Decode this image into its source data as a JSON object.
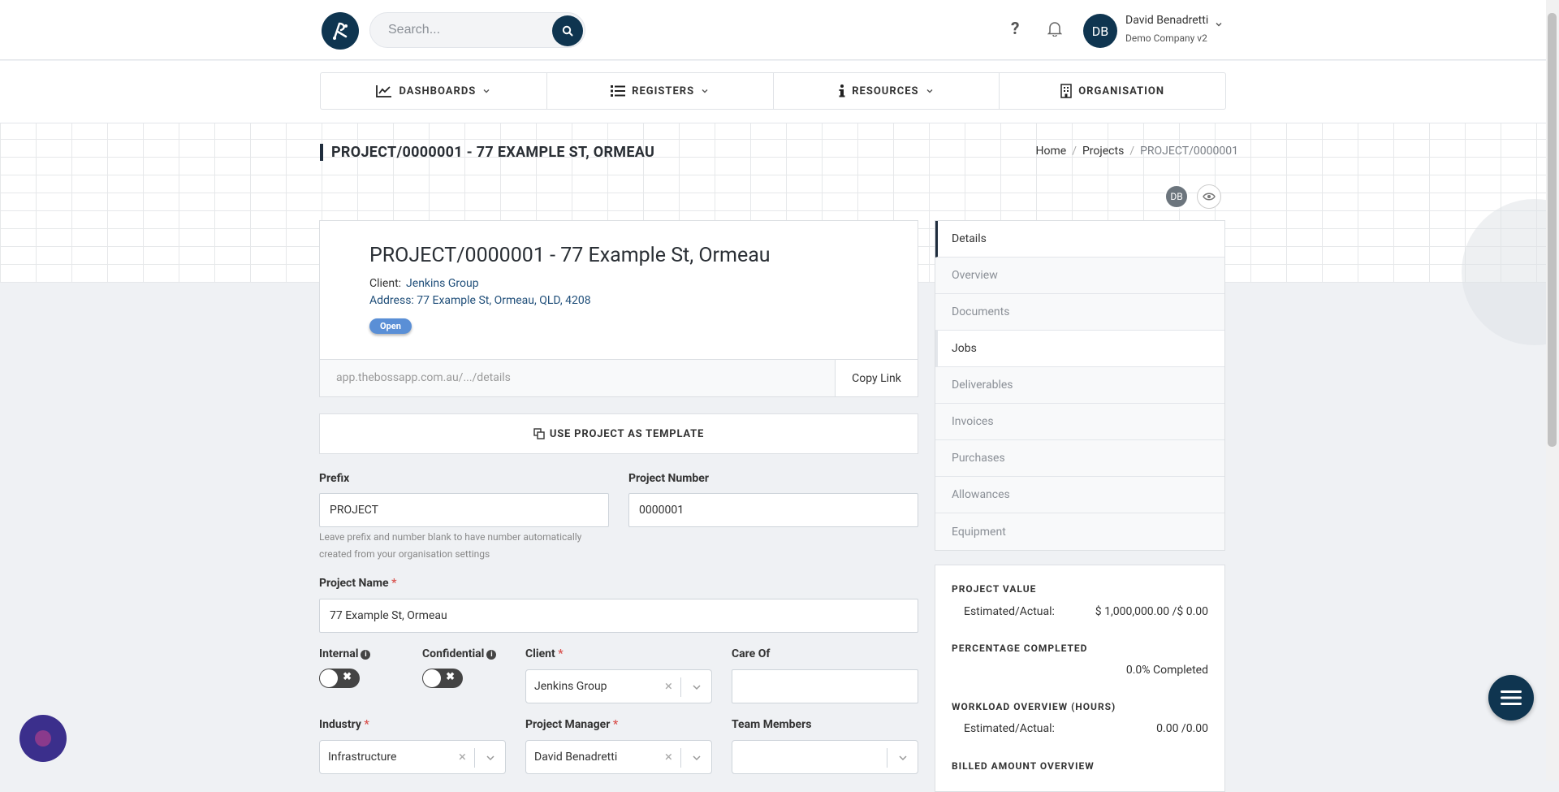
{
  "search": {
    "placeholder": "Search..."
  },
  "user": {
    "initials": "DB",
    "name": "David Benadretti",
    "company": "Demo Company v2"
  },
  "help_label": "?",
  "nav": [
    {
      "label": "DASHBOARDS",
      "icon": "chart-line-icon"
    },
    {
      "label": "REGISTERS",
      "icon": "list-icon"
    },
    {
      "label": "RESOURCES",
      "icon": "info-icon"
    },
    {
      "label": "ORGANISATION",
      "icon": "building-icon"
    }
  ],
  "page": {
    "title": "PROJECT/0000001 - 77 EXAMPLE ST, ORMEAU"
  },
  "breadcrumb": {
    "home": "Home",
    "projects": "Projects",
    "current": "PROJECT/0000001"
  },
  "viewer": {
    "initials": "DB"
  },
  "card": {
    "title": "PROJECT/0000001 - 77 Example St, Ormeau",
    "client_label": "Client:",
    "client_value": "Jenkins Group",
    "address": "Address: 77 Example St, Ormeau, QLD, 4208",
    "status": "Open",
    "url": "app.thebossapp.com.au/.../details",
    "copy_label": "Copy Link"
  },
  "template_button": "USE PROJECT AS TEMPLATE",
  "form": {
    "prefix_label": "Prefix",
    "prefix_value": "PROJECT",
    "number_label": "Project Number",
    "number_value": "0000001",
    "hint": "Leave prefix and number blank to have number automatically created from your organisation settings",
    "name_label": "Project Name",
    "name_value": "77 Example St, Ormeau",
    "internal_label": "Internal",
    "confidential_label": "Confidential",
    "client_label": "Client",
    "client_value": "Jenkins Group",
    "careof_label": "Care Of",
    "careof_value": "",
    "industry_label": "Industry",
    "industry_value": "Infrastructure",
    "manager_label": "Project Manager",
    "manager_value": "David Benadretti",
    "team_label": "Team Members",
    "team_value": "",
    "required_mark": "*"
  },
  "sidebar": {
    "items": [
      "Details",
      "Overview",
      "Documents",
      "Jobs",
      "Deliverables",
      "Invoices",
      "Purchases",
      "Allowances",
      "Equipment"
    ]
  },
  "summary": {
    "value_heading": "PROJECT VALUE",
    "value_label": "Estimated/Actual:",
    "value_amount": "$ 1,000,000.00 /$ 0.00",
    "pct_heading": "PERCENTAGE COMPLETED",
    "pct_value": "0.0% Completed",
    "workload_heading": "WORKLOAD OVERVIEW (HOURS)",
    "workload_label": "Estimated/Actual:",
    "workload_value": "0.00 /0.00",
    "billed_heading": "BILLED AMOUNT OVERVIEW"
  },
  "colors": {
    "brand": "#0f3550",
    "status_open": "#5a8fd6",
    "required": "#d9534f"
  }
}
